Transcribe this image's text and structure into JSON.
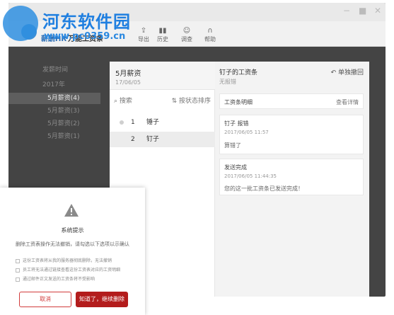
{
  "watermark": {
    "title": "河东软件园",
    "url": "www.pc0359.cn"
  },
  "app": {
    "brand": "薪酬HR",
    "brand_sub": "万能工资条",
    "toolbar": [
      {
        "icon": "upload-icon",
        "label": "导出"
      },
      {
        "icon": "history-icon",
        "label": "历史"
      },
      {
        "icon": "help-icon",
        "label": "调查"
      },
      {
        "icon": "headset-icon",
        "label": "帮助"
      }
    ]
  },
  "sidebar": {
    "items": [
      {
        "label": "发薪时间"
      },
      {
        "label": "2017年"
      },
      {
        "label": "5月薪资(4)",
        "active": true
      },
      {
        "label": "5月薪资(3)"
      },
      {
        "label": "5月薪资(2)"
      },
      {
        "label": "5月薪资(1)"
      }
    ]
  },
  "middle": {
    "title": "5月薪资",
    "date": "17/06/05",
    "search_label": "搜索",
    "sort_label": "按状态排序",
    "rows": [
      {
        "num": "1",
        "name": "锤子"
      },
      {
        "num": "2",
        "name": "钉子"
      }
    ]
  },
  "right": {
    "title": "钉子的工资条",
    "subtitle": "无报错",
    "back_label": "单独撤回",
    "details_header": "工资条明细",
    "details_link": "查看详情",
    "card1": {
      "title": "钉子 报错",
      "time": "2017/06/05 11:57",
      "text": "算错了"
    },
    "card2": {
      "title": "发送完成",
      "time": "2017/06/05 11:44:35",
      "text": "您的这一批工资条已发送完成！"
    }
  },
  "dialog": {
    "title": "系统提示",
    "desc": "删除工资表操作无法撤销，请勾选以下选项以示确认",
    "options": [
      "这份工资表将从我的服务器彻底删除，无法撤销",
      "员工将无法通过链接查看这份工资表对应的工资明细",
      "通过邮件正文发送的工资条将不受影响"
    ],
    "cancel_label": "取消",
    "confirm_label": "知道了，继续删除"
  },
  "colors": {
    "accent": "#b31c1c",
    "brand_blue": "#2e6fb5"
  }
}
